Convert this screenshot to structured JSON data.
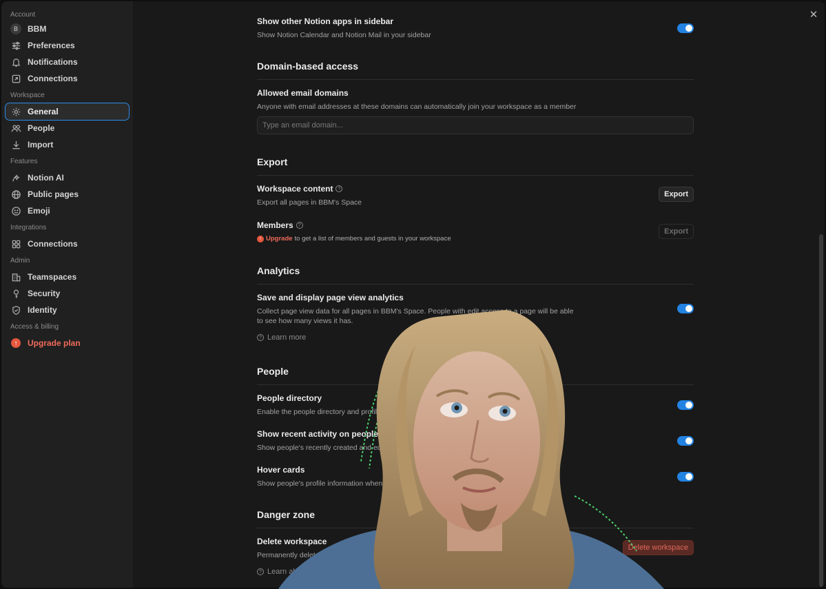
{
  "sidebar": {
    "sections": [
      {
        "label": "Account",
        "items": [
          {
            "label": "BBM",
            "icon": "avatar-b",
            "avatar_letter": "B"
          },
          {
            "label": "Preferences",
            "icon": "sliders-icon"
          },
          {
            "label": "Notifications",
            "icon": "bell-icon"
          },
          {
            "label": "Connections",
            "icon": "arrow-box-icon"
          }
        ]
      },
      {
        "label": "Workspace",
        "items": [
          {
            "label": "General",
            "icon": "gear-icon",
            "active": true
          },
          {
            "label": "People",
            "icon": "people-icon"
          },
          {
            "label": "Import",
            "icon": "download-icon"
          }
        ]
      },
      {
        "label": "Features",
        "items": [
          {
            "label": "Notion AI",
            "icon": "ai-icon"
          },
          {
            "label": "Public pages",
            "icon": "globe-icon"
          },
          {
            "label": "Emoji",
            "icon": "smiley-icon"
          }
        ]
      },
      {
        "label": "Integrations",
        "items": [
          {
            "label": "Connections",
            "icon": "grid-icon"
          }
        ]
      },
      {
        "label": "Admin",
        "items": [
          {
            "label": "Teamspaces",
            "icon": "building-icon"
          },
          {
            "label": "Security",
            "icon": "key-icon"
          },
          {
            "label": "Identity",
            "icon": "shield-icon"
          }
        ]
      },
      {
        "label": "Access & billing",
        "items": [
          {
            "label": "Upgrade plan",
            "icon": "upgrade-icon"
          }
        ]
      }
    ]
  },
  "settings": {
    "notion_apps": {
      "title": "Show other Notion apps in sidebar",
      "desc": "Show Notion Calendar and Notion Mail in your sidebar",
      "enabled": true
    },
    "domain": {
      "heading": "Domain-based access",
      "title": "Allowed email domains",
      "desc": "Anyone with email addresses at these domains can automatically join your workspace as a member",
      "placeholder": "Type an email domain..."
    },
    "export": {
      "heading": "Export",
      "workspace_title": "Workspace content",
      "workspace_desc": "Export all pages in BBM's Space",
      "workspace_button": "Export",
      "members_title": "Members",
      "members_upgrade": "Upgrade",
      "members_desc": "to get a list of members and guests in your workspace",
      "members_button": "Export"
    },
    "analytics": {
      "heading": "Analytics",
      "title": "Save and display page view analytics",
      "desc": "Collect page view data for all pages in BBM's Space. People with edit access to a page will be able to see how many views it has.",
      "learn_more": "Learn more",
      "enabled": true
    },
    "people": {
      "heading": "People",
      "directory_title": "People directory",
      "directory_desc": "Enable the people directory and profile pages",
      "activity_title": "Show recent activity on people profiles",
      "activity_desc": "Show people's recently created and edited",
      "hover_title": "Hover cards",
      "hover_desc": "Show people's profile information when"
    },
    "danger": {
      "heading": "Danger zone",
      "delete_title": "Delete workspace",
      "delete_desc": "Permanently delete th",
      "delete_button": "Delete workspace",
      "learn_more": "Learn ab"
    }
  },
  "colors": {
    "accent": "#2383e2",
    "danger": "#ef6b5b",
    "active_outline": "#2d8ceb"
  }
}
